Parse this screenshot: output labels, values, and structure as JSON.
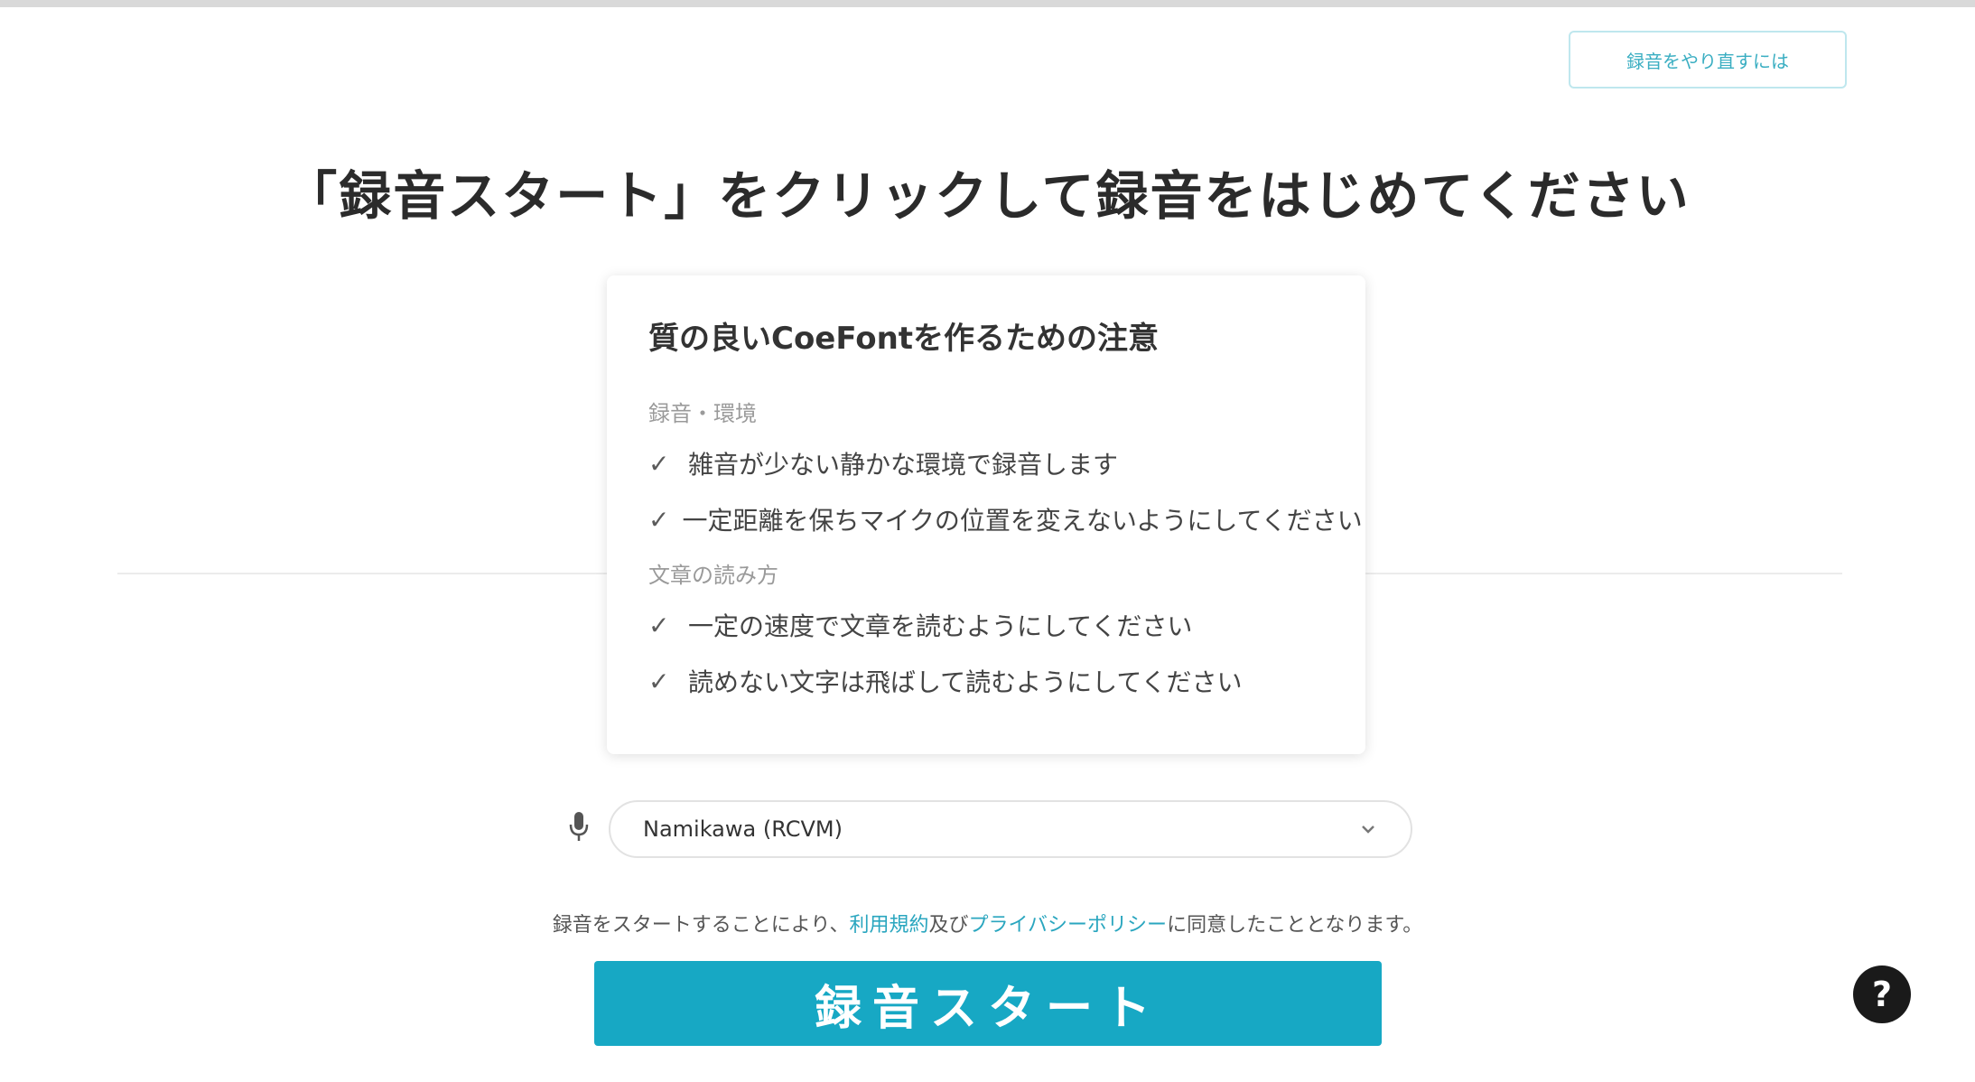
{
  "top_link": {
    "label": "録音をやり直すには"
  },
  "page": {
    "title": "「録音スタート」をクリックして録音をはじめてください"
  },
  "notice": {
    "title": "質の良いCoeFontを作るための注意",
    "sections": [
      {
        "heading": "録音・環境",
        "items": [
          "雑音が少ない静かな環境で録音します",
          "一定距離を保ちマイクの位置を変えないようにしてください"
        ]
      },
      {
        "heading": "文章の読み方",
        "items": [
          "一定の速度で文章を読むようにしてください",
          "読めない文字は飛ばして読むようにしてください"
        ]
      }
    ]
  },
  "device": {
    "selected": "Namikawa (RCVM)"
  },
  "consent": {
    "prefix": "録音をスタートすることにより、",
    "terms_link": "利用規約",
    "middle": "及び",
    "privacy_link": "プライバシーポリシー",
    "suffix": "に同意したこととなります。"
  },
  "start_button": {
    "label": "録音スタート"
  },
  "help": {
    "label": "?"
  },
  "icons": {
    "check": "check-icon",
    "mic": "microphone-icon",
    "chevron": "chevron-down-icon",
    "help": "help-icon"
  },
  "colors": {
    "accent": "#17a8c4",
    "link": "#2aa6bf",
    "help_bg": "#1a1a1a"
  }
}
